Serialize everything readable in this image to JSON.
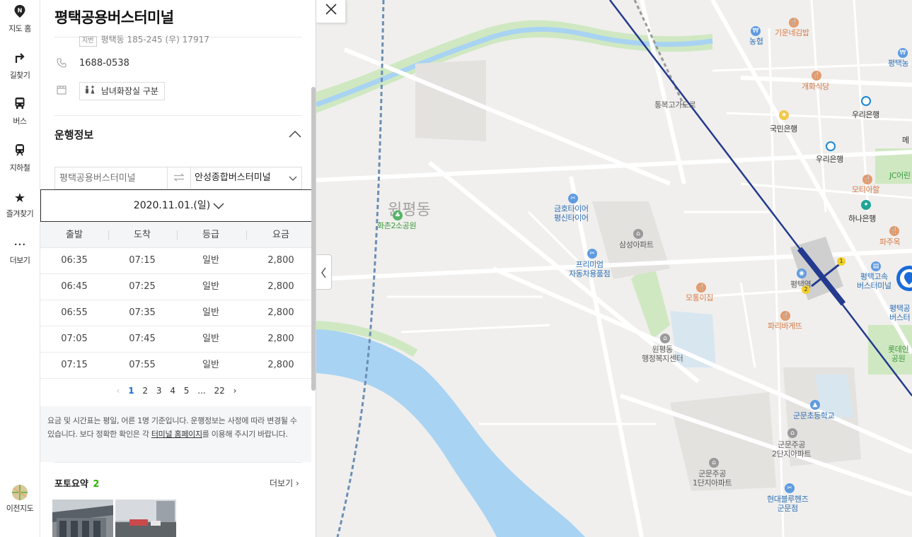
{
  "rail": {
    "items": [
      {
        "label": "지도 홈",
        "icon": "map-home-icon"
      },
      {
        "label": "길찾기",
        "icon": "directions-icon"
      },
      {
        "label": "버스",
        "icon": "bus-icon"
      },
      {
        "label": "지하철",
        "icon": "subway-icon"
      },
      {
        "label": "즐겨찾기",
        "icon": "star-icon"
      },
      {
        "label": "더보기",
        "icon": "more-icon"
      }
    ],
    "legacy_label": "이전지도"
  },
  "place": {
    "title": "평택공용버스터미널",
    "address_badge": "지번",
    "address": "평택동 185-245 (우) 17917",
    "phone": "1688-0538",
    "restroom": "남녀화장실 구분"
  },
  "schedule": {
    "section_title": "운행정보",
    "from_placeholder": "평택공용버스터미널",
    "to_value": "안성종합버스터미널",
    "date": "2020.11.01.(일)",
    "columns": [
      "출발",
      "도착",
      "등급",
      "요금"
    ],
    "rows": [
      [
        "06:35",
        "07:15",
        "일반",
        "2,800"
      ],
      [
        "06:45",
        "07:25",
        "일반",
        "2,800"
      ],
      [
        "06:55",
        "07:35",
        "일반",
        "2,800"
      ],
      [
        "07:05",
        "07:45",
        "일반",
        "2,800"
      ],
      [
        "07:15",
        "07:55",
        "일반",
        "2,800"
      ]
    ],
    "pager": {
      "prev": "‹",
      "pages": [
        "1",
        "2",
        "3",
        "4",
        "5",
        "...",
        "22"
      ],
      "next": "›",
      "current": "1"
    },
    "notice_part1": "요금 및 시간표는 평일, 어른 1명 기준입니다. 운행정보는 사정에 따라 변경될 수 있습니다. 보다 정확한 확인은 각 ",
    "notice_link": "터미널 홈페이지",
    "notice_part2": "를 이용해 주시기 바랍니다."
  },
  "photos": {
    "title": "포토요약",
    "count": "2",
    "more": "더보기"
  },
  "map": {
    "area_label": "원평동",
    "labels": {
      "giunne": "기운네김밥",
      "nonghyup": "농협",
      "pyeongtaeknong": "평택농",
      "gaehwa": "개화식당",
      "woori1": "우리은행",
      "tongbok": "통복고가도로",
      "kookmin": "국민은행",
      "woori2": "우리은행",
      "me": "메",
      "jc": "JC어린",
      "motiha": "모티아할",
      "hana": "하나은행",
      "pajuk": "파주옥",
      "geumho": "금호타이어\n평신타이어",
      "hwachon": "화촌2소공원",
      "samsung": "삼성아파트",
      "premium": "프리미엄\n자동차용품점",
      "station": "평택역",
      "express": "평택고속\n버스터미널",
      "pyeongtaek_bus": "평택공\n버스터",
      "motong": "모통이집",
      "paris": "파리바게뜨",
      "wonpyeong_office": "원평동\n행정복지센터",
      "lotte": "롯데인\n공원",
      "gunmun_school": "군문초등학교",
      "gunmun2": "군문주공\n2단지아파트",
      "gunmun1": "군문주공\n1단지아파트",
      "hyundai": "현대블루헨즈\n군문점"
    },
    "colors": {
      "water": "#a9d3f2",
      "park": "#cfe8c2",
      "road": "#ffffff",
      "block": "#e4e2df",
      "rail_line": "#233a8f",
      "dashed_line": "#6b8fb5"
    }
  }
}
